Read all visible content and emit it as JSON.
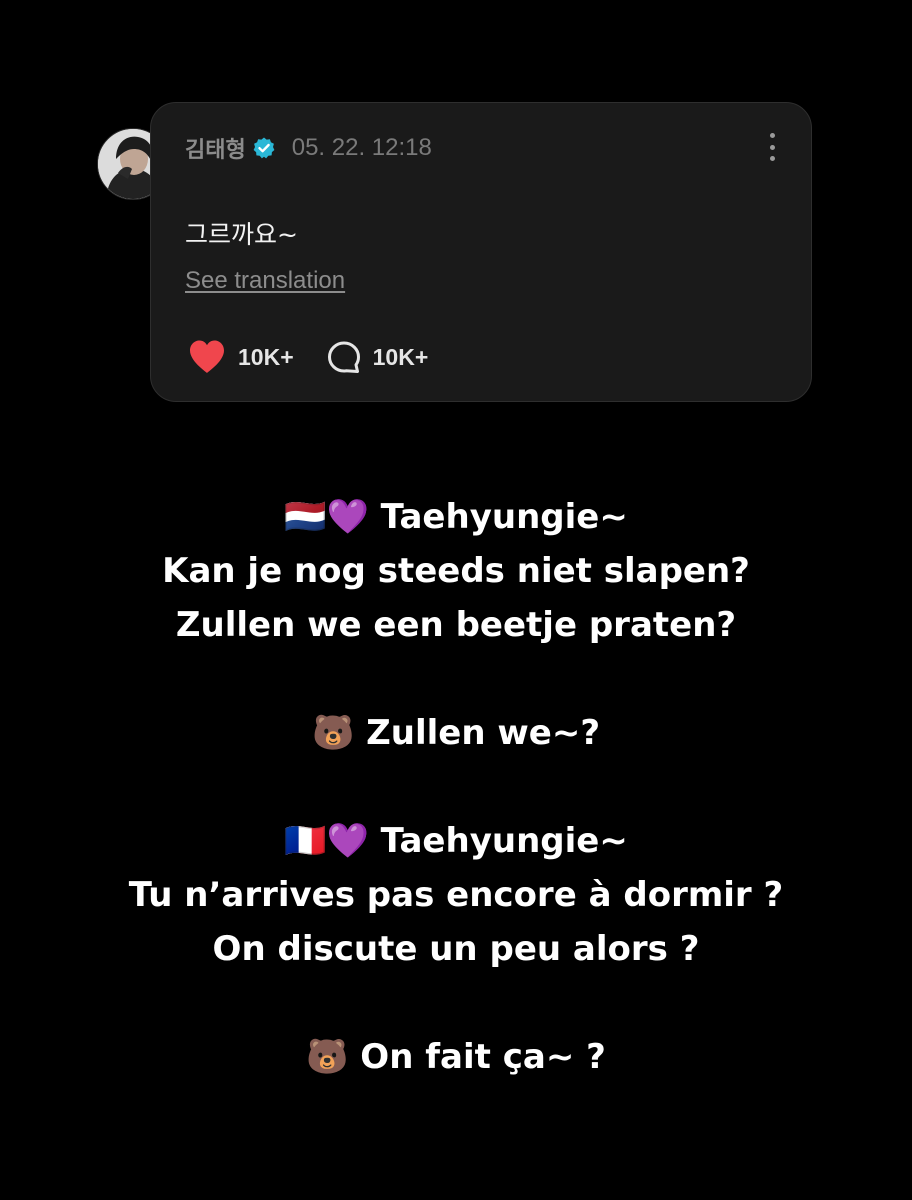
{
  "post": {
    "author": "김태형",
    "timestamp": "05. 22. 12:18",
    "text": "그르까요~",
    "see_translation": "See translation",
    "likes": "10K+",
    "comments": "10K+",
    "verified_color": "#2ab7d6",
    "like_color": "#f0464d"
  },
  "caption": {
    "line1": "🇳🇱💜 Taehyungie~",
    "line2": "Kan je nog steeds niet slapen?",
    "line3": "Zullen we een beetje praten?",
    "line4": "🐻 Zullen we~?",
    "line5": "🇫🇷💜 Taehyungie∼",
    "line6": "Tu n’arrives pas encore à dormir ?",
    "line7": "On discute un peu alors ?",
    "line8": "🐻 On fait ça~ ?"
  }
}
